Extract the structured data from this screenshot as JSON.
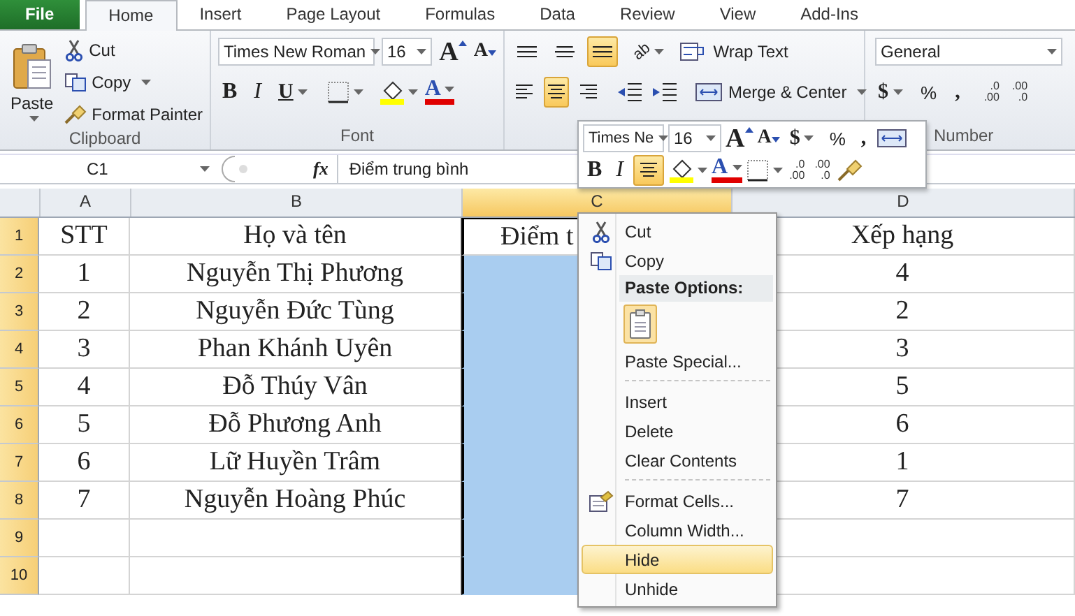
{
  "tabs": [
    {
      "label": "File",
      "kind": "file",
      "selected": false
    },
    {
      "label": "Home",
      "kind": "tab",
      "selected": true
    },
    {
      "label": "Insert",
      "kind": "tab",
      "selected": false
    },
    {
      "label": "Page Layout",
      "kind": "tab",
      "selected": false
    },
    {
      "label": "Formulas",
      "kind": "tab",
      "selected": false
    },
    {
      "label": "Data",
      "kind": "tab",
      "selected": false
    },
    {
      "label": "Review",
      "kind": "tab",
      "selected": false
    },
    {
      "label": "View",
      "kind": "tab",
      "selected": false
    },
    {
      "label": "Add-Ins",
      "kind": "tab",
      "selected": false
    }
  ],
  "clipboard": {
    "label": "Clipboard",
    "paste": "Paste",
    "cut": "Cut",
    "copy": "Copy",
    "format_painter": "Format Painter"
  },
  "font": {
    "label": "Font",
    "font_name": "Times New Roman",
    "font_size": "16",
    "grow": "A",
    "shrink": "A",
    "bold": "B",
    "italic": "I",
    "underline": "U",
    "font_color": "A"
  },
  "alignment": {
    "vertical": [
      {
        "kind": "top",
        "selected": false
      },
      {
        "kind": "middle",
        "selected": false
      },
      {
        "kind": "bottom",
        "selected": true
      }
    ],
    "horizontal": [
      {
        "kind": "left",
        "selected": false
      },
      {
        "kind": "center",
        "selected": true
      },
      {
        "kind": "right",
        "selected": false
      }
    ],
    "orientation": "ab",
    "wrap_text": "Wrap Text",
    "merge_center": "Merge & Center"
  },
  "number": {
    "label": "Number",
    "format": "General",
    "currency": "$",
    "percent": "%",
    "comma": ",",
    "increase_decimal": [
      ".0",
      ".00"
    ],
    "decrease_decimal": [
      ".00",
      ".0"
    ]
  },
  "formula_bar": {
    "name_box": "C1",
    "fx": "fx",
    "value": "Điểm trung bình"
  },
  "columns": [
    {
      "label": "A",
      "selected": false
    },
    {
      "label": "B",
      "selected": false
    },
    {
      "label": "C",
      "selected": true
    },
    {
      "label": "D",
      "selected": false
    }
  ],
  "rows": [
    {
      "header": "1",
      "highlighted": true,
      "stt": "STT",
      "name": "Họ và tên",
      "score": "Điểm t",
      "rank": "Xếp hạng"
    },
    {
      "header": "2",
      "highlighted": true,
      "stt": "1",
      "name": "Nguyễn Thị Phương",
      "rank": "4"
    },
    {
      "header": "3",
      "highlighted": true,
      "stt": "2",
      "name": "Nguyễn Đức Tùng",
      "rank": "2"
    },
    {
      "header": "4",
      "highlighted": true,
      "stt": "3",
      "name": "Phan Khánh Uyên",
      "rank": "3"
    },
    {
      "header": "5",
      "highlighted": true,
      "stt": "4",
      "name": "Đỗ Thúy Vân",
      "rank": "5"
    },
    {
      "header": "6",
      "highlighted": true,
      "stt": "5",
      "name": "Đỗ Phương Anh",
      "rank": "6"
    },
    {
      "header": "7",
      "highlighted": true,
      "stt": "6",
      "name": "Lữ Huyền Trâm",
      "rank": "1"
    },
    {
      "header": "8",
      "highlighted": true,
      "stt": "7",
      "name": "Nguyễn Hoàng Phúc",
      "rank": "7"
    },
    {
      "header": "9",
      "highlighted": true
    },
    {
      "header": "10",
      "highlighted": true
    }
  ],
  "mini_toolbar": {
    "font_name": "Times Ne",
    "font_size": "16",
    "grow": "A",
    "shrink": "A",
    "currency": "$",
    "percent": "%",
    "comma": ",",
    "bold": "B",
    "italic": "I",
    "font_color": "A",
    "increase_decimal": [
      ".0",
      ".00"
    ],
    "decrease_decimal": [
      ".00",
      ".0"
    ],
    "center_selected": true
  },
  "context_menu": [
    {
      "kind": "command",
      "label": "Cut",
      "selected": false
    },
    {
      "kind": "command",
      "label": "Copy",
      "selected": false
    },
    {
      "kind": "header",
      "label": "Paste Options:"
    },
    {
      "kind": "paste_option"
    },
    {
      "kind": "command",
      "label": "Paste Special...",
      "selected": false
    },
    {
      "kind": "separator"
    },
    {
      "kind": "command",
      "label": "Insert",
      "selected": false
    },
    {
      "kind": "command",
      "label": "Delete",
      "selected": false
    },
    {
      "kind": "command",
      "label": "Clear Contents",
      "selected": false
    },
    {
      "kind": "separator"
    },
    {
      "kind": "command",
      "label": "Format Cells...",
      "selected": false
    },
    {
      "kind": "command",
      "label": "Column Width...",
      "selected": false
    },
    {
      "kind": "command",
      "label": "Hide",
      "selected": true
    },
    {
      "kind": "command",
      "label": "Unhide",
      "selected": false
    }
  ]
}
